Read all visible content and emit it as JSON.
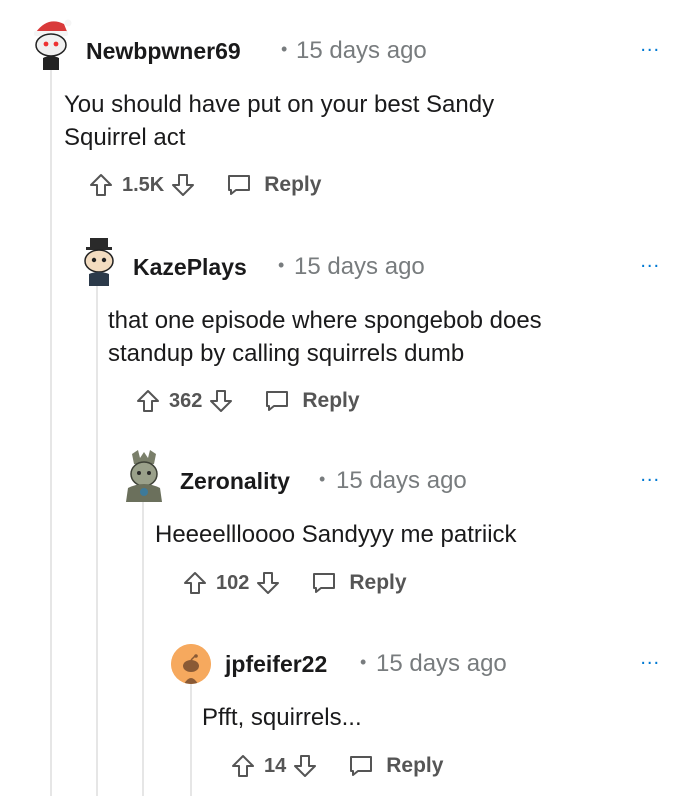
{
  "comments": [
    {
      "username": "Newbpwner69",
      "time": "15 days ago",
      "text": "You should have put on your best Sandy Squirrel act",
      "score": "1.5K",
      "reply_label": "Reply",
      "more_label": "...",
      "avatar_icon": "snoo-santa-hat-avatar"
    },
    {
      "username": "KazePlays",
      "time": "15 days ago",
      "text": "that one episode where spongebob does standup by calling squirrels dumb",
      "score": "362",
      "reply_label": "Reply",
      "more_label": "...",
      "avatar_icon": "snoo-top-hat-avatar"
    },
    {
      "username": "Zeronality",
      "time": "15 days ago",
      "text": "Heeeellloooo Sandyyy me patriick",
      "score": "102",
      "reply_label": "Reply",
      "more_label": "...",
      "avatar_icon": "armored-character-avatar"
    },
    {
      "username": "jpfeifer22",
      "time": "15 days ago",
      "text": "Pfft, squirrels...",
      "score": "14",
      "reply_label": "Reply",
      "more_label": "...",
      "avatar_icon": "default-orange-snoo-avatar"
    }
  ],
  "colors": {
    "accent": "#0079d3",
    "muted": "#787c7e",
    "thread_line": "#e6e6e6",
    "avatar_orange": "#f6a95e"
  }
}
